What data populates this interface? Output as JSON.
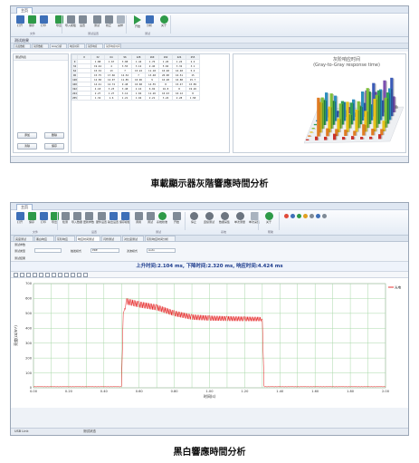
{
  "window1": {
    "menu_tab": "主页",
    "ribbon_buttons": [
      "打开",
      "保存",
      "打印",
      "导出",
      "导入模板",
      "设置",
      "测试",
      "校正",
      "采样",
      "开始",
      "分析",
      "关于"
    ],
    "ribbon_groups": [
      "文件",
      "测试设置",
      "测试"
    ],
    "subheader": "测试结果",
    "tabs": [
      "亮度数据",
      "灰阶数据",
      "Gray分析",
      "响应时间",
      "灰阶响应",
      "灰阶响应时间"
    ],
    "left_pane_title": "测试列表",
    "left_buttons": [
      "添加",
      "删除",
      "清除",
      "保存"
    ],
    "table": {
      "headers": [
        "",
        "0",
        "32",
        "64",
        "96",
        "128",
        "160",
        "192",
        "224",
        "255"
      ],
      "rows": [
        [
          "0",
          "",
          "1.88",
          "1.67",
          "3.08",
          "1.44",
          "1.76",
          "1.26",
          "1.24",
          "2.4"
        ],
        [
          "32",
          "",
          "19.44",
          "4",
          "3.55",
          "3.12",
          "2.46",
          "5.66",
          "3.32",
          "3.1"
        ],
        [
          "64",
          "",
          "15.32",
          "13",
          "7",
          "15.22",
          "11.18",
          "10.48",
          "16.48",
          "5.4"
        ],
        [
          "96",
          "",
          "15.75",
          "17.66",
          "12.52",
          "7",
          "13.48",
          "20.00",
          "16.51",
          "15"
        ],
        [
          "128",
          "",
          "12.58",
          "12.07",
          "11.85",
          "10.96",
          "9",
          "16.28",
          "16.88",
          "15.7"
        ],
        [
          "160",
          "",
          "14.41",
          "12.74",
          "9.48",
          "10.68",
          "14.55",
          "8",
          "15.47",
          "15.89"
        ],
        [
          "192",
          "",
          "4.18",
          "3.23",
          "3.48",
          "2.16",
          "6.92",
          "16.8",
          "8",
          "19.26"
        ],
        [
          "224",
          "",
          "2.27",
          "1.27",
          "3.12",
          "1.04",
          "11.26",
          "10.43",
          "16.12",
          "8"
        ],
        [
          "255",
          "",
          "1.32",
          "1.6",
          "1.21",
          "1.94",
          "2.21",
          "3.24",
          "2.28",
          "1.58"
        ]
      ]
    },
    "chart_title": "灰阶响应时间",
    "chart_subtitle": "(Gray-to-Gray response time)"
  },
  "caption1": "車載顯示器灰階響應時間分析",
  "window2": {
    "menu_tab": "主页",
    "ribbon_buttons": [
      "打开",
      "保存",
      "打印",
      "导出",
      "检测",
      "导入数据",
      "更新参数",
      "硬件设置",
      "输出设置",
      "保存模板",
      "调用",
      "调试",
      "系统校准",
      "开始",
      "停止",
      "连续测试",
      "数据采集",
      "单次测量",
      "单次采集",
      "关于"
    ],
    "ribbon_groups": [
      "文件",
      "设置",
      "测试",
      "系统",
      "帮助"
    ],
    "tabs": [
      "亮度测试",
      "黑白响应",
      "灰阶响应",
      "响应时间测试",
      "闪烁测试",
      "对比度测试",
      "灰阶响应时间分析"
    ],
    "form": {
      "section_label": "测试参数",
      "field1_label": "测试类型",
      "field2_label": "触发模式",
      "field2_value": "PRE",
      "field3_label": "滤波模式",
      "field3_value": "Auto",
      "section2_label": "测试结果"
    },
    "result_text": "上升时间:2.104 ms, 下降时间:2.320 ms, 响应时间:4.424 ms",
    "status_left": "USB Link",
    "status_mid": "测试状态"
  },
  "chart_data": {
    "type": "line",
    "title": "",
    "xlabel": "时间(s)",
    "ylabel": "亮度(cd/m²)",
    "legend": [
      "— 光电"
    ],
    "legend_position": "top-right",
    "xlim": [
      0,
      2.0
    ],
    "ylim": [
      0,
      700
    ],
    "x_ticks": [
      "0.00",
      "0.10",
      "0.20",
      "0.30",
      "0.40",
      "0.50",
      "0.60",
      "0.70",
      "0.80",
      "0.90",
      "1.00",
      "1.10",
      "1.20",
      "1.30",
      "1.40",
      "1.50",
      "1.60",
      "1.70",
      "1.80",
      "1.90",
      "2.00"
    ],
    "y_ticks": [
      "0",
      "100",
      "200",
      "300",
      "400",
      "500",
      "600",
      "700"
    ],
    "grid": true,
    "series": [
      {
        "name": "光电",
        "color": "#e00000",
        "x": [
          0,
          0.5,
          0.51,
          0.53,
          0.6,
          0.7,
          0.8,
          0.9,
          1.0,
          1.1,
          1.2,
          1.28,
          1.3,
          1.31,
          1.4,
          1.6,
          1.8,
          2.0
        ],
        "y": [
          8,
          8,
          500,
          580,
          560,
          540,
          500,
          475,
          468,
          465,
          463,
          462,
          460,
          8,
          8,
          8,
          8,
          8
        ]
      }
    ]
  }
}
